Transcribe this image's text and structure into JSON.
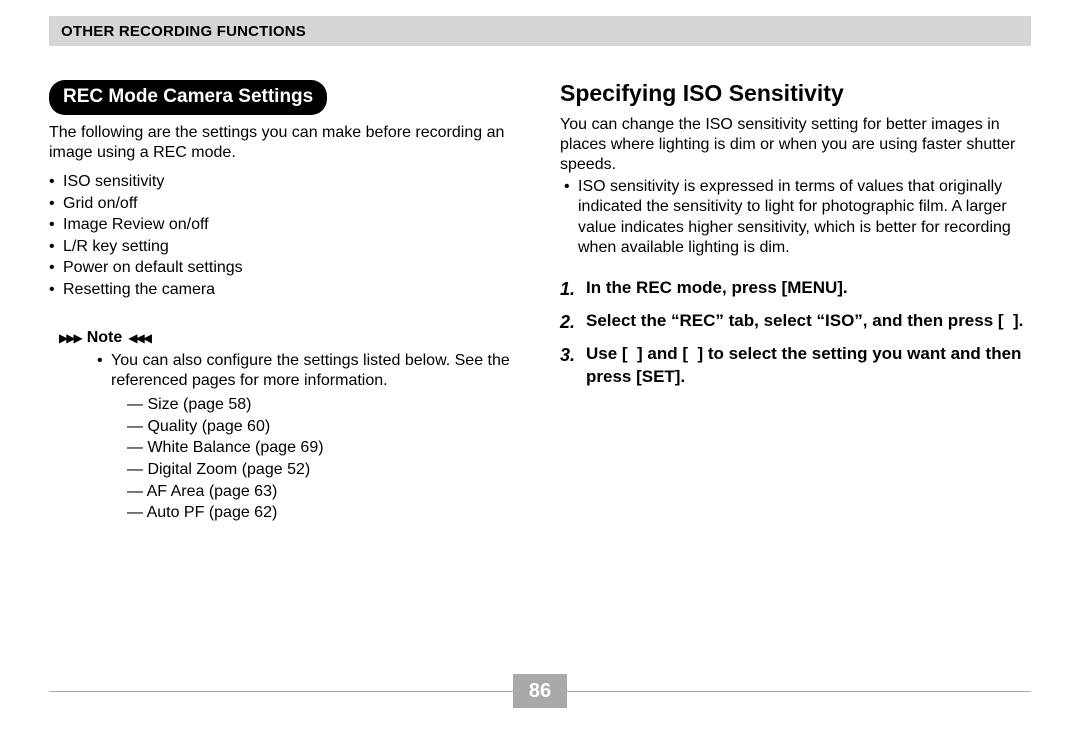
{
  "header": {
    "section_title": "Other Recording Functions"
  },
  "left": {
    "pill": "REC Mode Camera Settings",
    "intro": "The following are the settings you can make before recording an image using a REC mode.",
    "bullets": [
      "ISO sensitivity",
      "Grid on/off",
      "Image Review on/off",
      "L/R key setting",
      "Power on default settings",
      "Resetting the camera"
    ],
    "note_label": "Note",
    "note_text": "You can also configure the settings listed below. See the referenced pages for more information.",
    "note_refs": [
      "— Size (page 58)",
      "— Quality (page 60)",
      "— White Balance (page 69)",
      "— Digital Zoom (page 52)",
      "— AF Area (page 63)",
      "— Auto PF (page 62)"
    ]
  },
  "right": {
    "heading": "Specifying ISO Sensitivity",
    "intro": "You can change the ISO sensitivity setting for better images in places where lighting is dim or when you are using faster shutter speeds.",
    "bullet": "ISO sensitivity is expressed in terms of values that originally indicated the sensitivity to light for photographic film. A larger value indicates higher sensitivity, which is better for recording when available lighting is dim.",
    "steps": [
      "In the REC mode, press [MENU].",
      "Select the “REC” tab, select “ISO”, and then press [  ].",
      "Use [  ] and [  ] to select the setting you want and then press [SET]."
    ]
  },
  "page_number": "86"
}
